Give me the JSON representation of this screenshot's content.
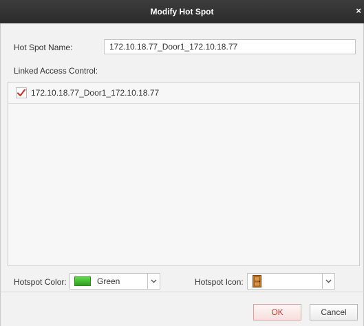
{
  "dialog": {
    "title": "Modify Hot Spot",
    "close_glyph": "×"
  },
  "form": {
    "name_label": "Hot Spot Name:",
    "name_value": "172.10.18.77_Door1_172.10.18.77",
    "linked_label": "Linked Access Control:",
    "linked_items": [
      {
        "label": "172.10.18.77_Door1_172.10.18.77",
        "checked": true
      }
    ],
    "color_label": "Hotspot Color:",
    "color_value": "Green",
    "color_swatch": "#3cbf2b",
    "icon_label": "Hotspot Icon:",
    "icon_value": "door-icon"
  },
  "buttons": {
    "ok": "OK",
    "cancel": "Cancel"
  },
  "colors": {
    "titlebar": "#333333",
    "accent": "#c0392b"
  }
}
